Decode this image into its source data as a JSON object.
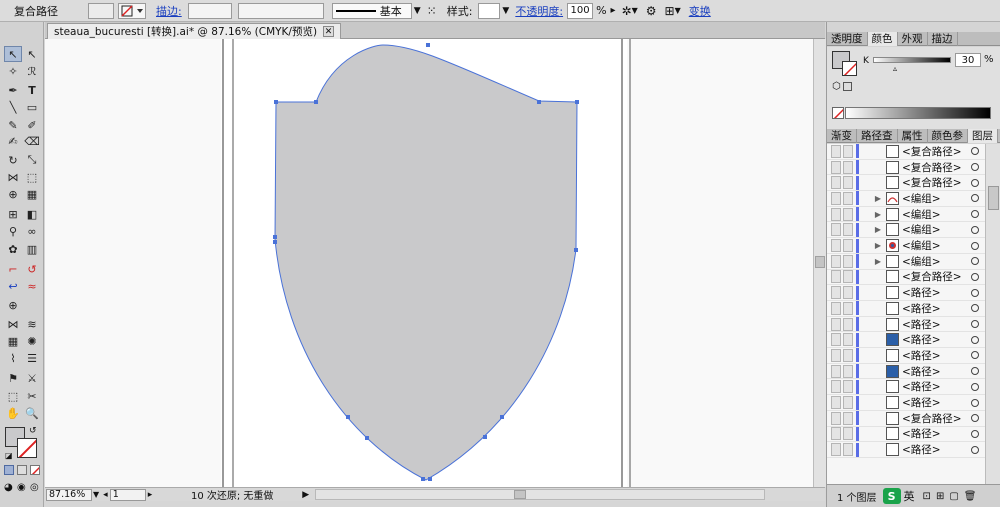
{
  "control_bar": {
    "selection_label": "复合路径",
    "stroke_label": "描边:",
    "stroke_profile": "基本",
    "style_label": "样式:",
    "opacity_label": "不透明度:",
    "opacity_value": "100",
    "opacity_unit": "%",
    "transform_label": "变换"
  },
  "document": {
    "tab_title": "steaua_bucuresti [转换].ai* @ 87.16% (CMYK/预览)",
    "close_label": "✕"
  },
  "status_bar": {
    "zoom": "87.16%",
    "artboard": "1",
    "undo_status": "10 次还原; 无重做"
  },
  "color_panel": {
    "tabs": [
      "透明度",
      "颜色",
      "外观",
      "描边"
    ],
    "active_tab": "颜色",
    "k_label": "K",
    "k_value": "30",
    "k_unit": "%"
  },
  "layers_panel": {
    "tabs": [
      "渐变",
      "路径查",
      "属性",
      "颜色参",
      "图层"
    ],
    "active_tab": "图层",
    "rows": [
      {
        "name": "<复合路径>",
        "expandable": false,
        "thumb": "white"
      },
      {
        "name": "<复合路径>",
        "expandable": false,
        "thumb": "white"
      },
      {
        "name": "<复合路径>",
        "expandable": false,
        "thumb": "white"
      },
      {
        "name": "<编组>",
        "expandable": true,
        "thumb": "arc"
      },
      {
        "name": "<编组>",
        "expandable": true,
        "thumb": "white"
      },
      {
        "name": "<编组>",
        "expandable": true,
        "thumb": "white"
      },
      {
        "name": "<编组>",
        "expandable": true,
        "thumb": "emblem"
      },
      {
        "name": "<编组>",
        "expandable": true,
        "thumb": "white"
      },
      {
        "name": "<复合路径>",
        "expandable": false,
        "thumb": "white"
      },
      {
        "name": "<路径>",
        "expandable": false,
        "thumb": "white"
      },
      {
        "name": "<路径>",
        "expandable": false,
        "thumb": "white"
      },
      {
        "name": "<路径>",
        "expandable": false,
        "thumb": "white"
      },
      {
        "name": "<路径>",
        "expandable": false,
        "thumb": "blue"
      },
      {
        "name": "<路径>",
        "expandable": false,
        "thumb": "white"
      },
      {
        "name": "<路径>",
        "expandable": false,
        "thumb": "blue"
      },
      {
        "name": "<路径>",
        "expandable": false,
        "thumb": "white"
      },
      {
        "name": "<路径>",
        "expandable": false,
        "thumb": "white"
      },
      {
        "name": "<复合路径>",
        "expandable": false,
        "thumb": "white"
      },
      {
        "name": "<路径>",
        "expandable": false,
        "thumb": "white"
      },
      {
        "name": "<路径>",
        "expandable": false,
        "thumb": "white"
      }
    ],
    "footer_label": "1 个图层",
    "ime_label": "英"
  },
  "colors": {
    "accent": "#5a6de6",
    "shield_fill": "#c9c9cb",
    "path_stroke": "#4a72d8"
  }
}
